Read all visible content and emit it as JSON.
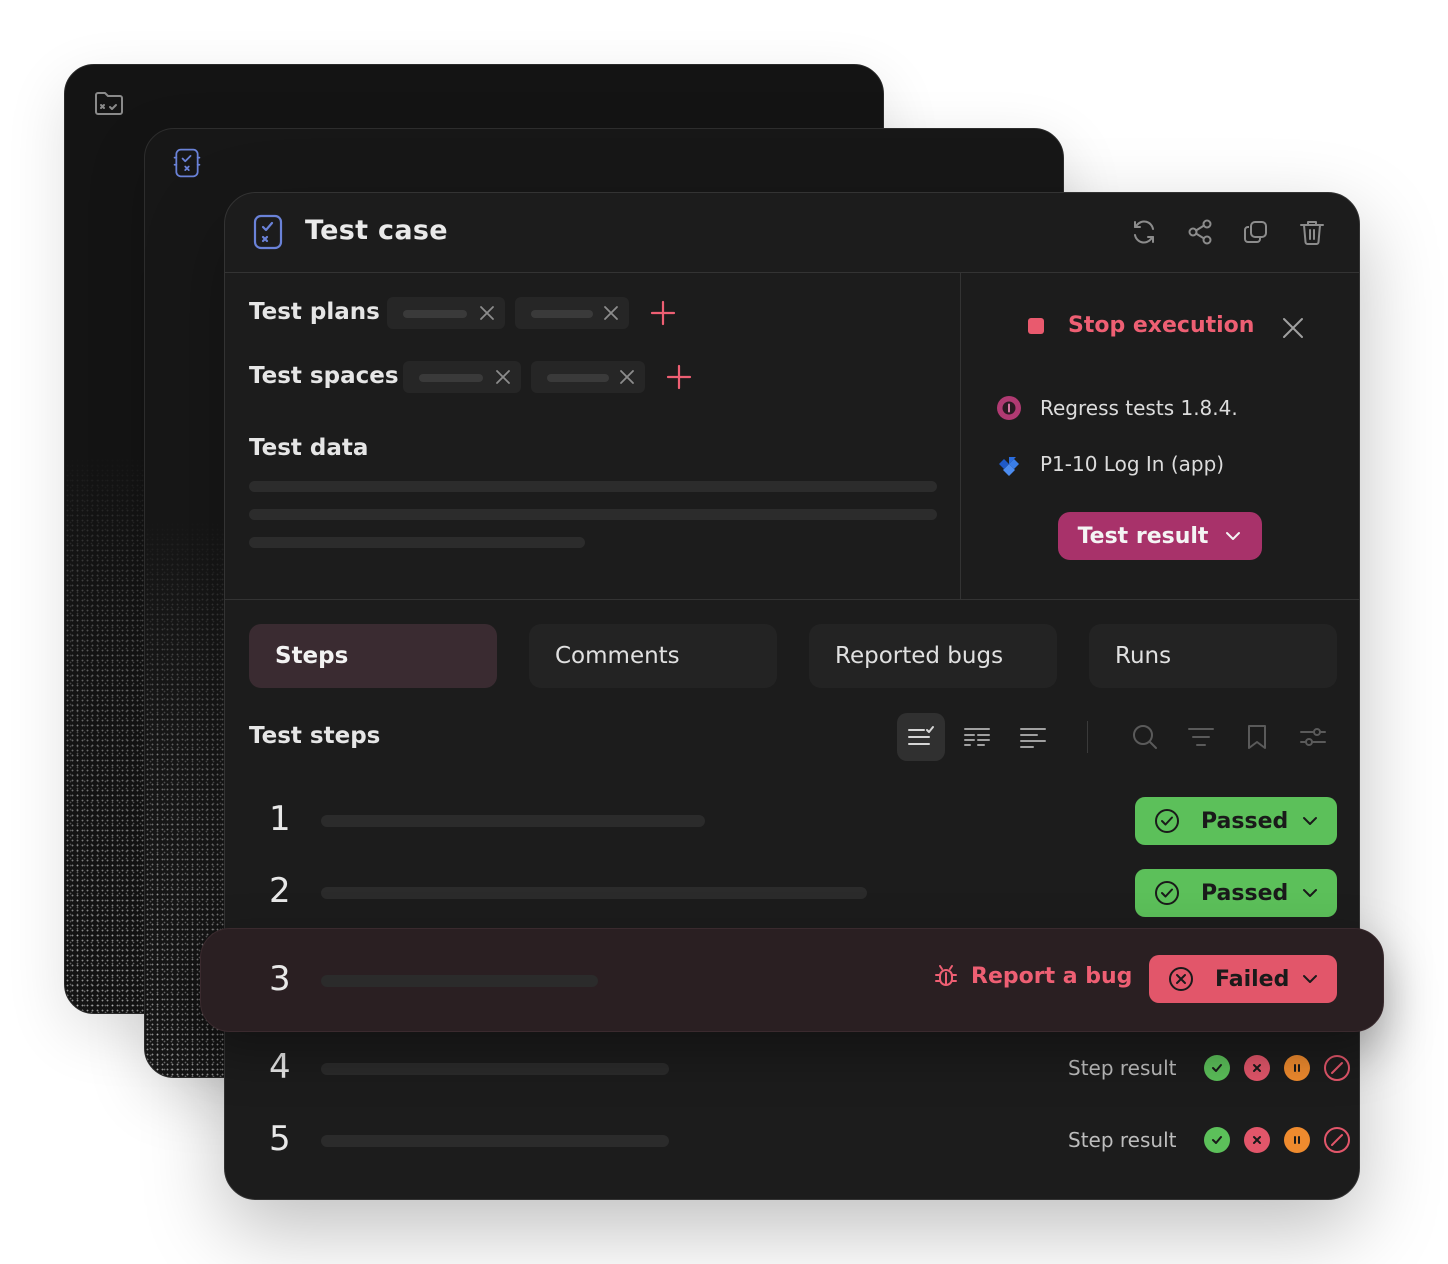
{
  "header": {
    "title": "Test case"
  },
  "fields": {
    "test_plans_label": "Test plans",
    "test_spaces_label": "Test spaces",
    "test_data_label": "Test data"
  },
  "execution": {
    "stop_label": "Stop execution",
    "run_name": "Regress tests 1.8.4.",
    "issue_name": "P1-10 Log In (app)",
    "test_result_label": "Test result"
  },
  "tabs": [
    {
      "label": "Steps",
      "active": true
    },
    {
      "label": "Comments",
      "active": false
    },
    {
      "label": "Reported bugs",
      "active": false
    },
    {
      "label": "Runs",
      "active": false
    }
  ],
  "steps_section": {
    "title": "Test steps"
  },
  "steps": [
    {
      "number": "1",
      "status": "Passed"
    },
    {
      "number": "2",
      "status": "Passed"
    },
    {
      "number": "3",
      "status": "Failed",
      "action": "Report a bug"
    },
    {
      "number": "4",
      "result_label": "Step result"
    },
    {
      "number": "5",
      "result_label": "Step result"
    }
  ],
  "colors": {
    "accent": "#a8326a",
    "danger": "#e2566a",
    "success": "#5cc05a",
    "warning": "#ef8b2e",
    "link": "#ee5f73"
  },
  "icons": [
    "folder-check-icon",
    "clipboard-icon",
    "refresh-icon",
    "share-icon",
    "copy-icon",
    "trash-icon",
    "close-icon",
    "plus-icon",
    "stop-icon",
    "run-badge-icon",
    "jira-icon",
    "chevron-down-icon",
    "list-check-icon",
    "list-columns-icon",
    "list-align-icon",
    "search-icon",
    "filter-icon",
    "bookmark-icon",
    "sliders-icon",
    "bug-icon",
    "check-circle-icon",
    "x-circle-icon",
    "pause-icon",
    "block-icon"
  ]
}
